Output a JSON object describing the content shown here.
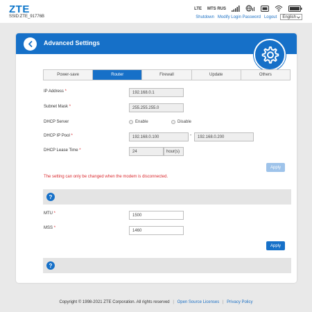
{
  "header": {
    "logo": "ZTE",
    "ssid": "SSID:ZTE_91776B",
    "network_type": "LTE",
    "operator": "MTS RUS",
    "links": {
      "shutdown": "Shutdown",
      "modify_password": "Modify Login Password",
      "logout": "Logout"
    },
    "language": "English"
  },
  "page": {
    "title": "Advanced Settings"
  },
  "tabs": [
    "Power-save",
    "Router",
    "Firewall",
    "Update",
    "Others"
  ],
  "active_tab": "Router",
  "router": {
    "ip_address_label": "IP Address",
    "ip_address": "192.168.0.1",
    "subnet_mask_label": "Subnet Mask",
    "subnet_mask": "255.255.255.0",
    "dhcp_server_label": "DHCP Server",
    "enable_label": "Enable",
    "disable_label": "Disable",
    "dhcp_pool_label": "DHCP IP Pool",
    "dhcp_pool_start": "192.168.0.100",
    "dhcp_pool_dash": "-",
    "dhcp_pool_end": "192.168.0.200",
    "lease_label": "DHCP Lease Time",
    "lease_value": "24",
    "lease_unit": "hour(s)",
    "apply_label": "Apply",
    "warning": "The setting can only be changed when the modem is disconnected."
  },
  "mtu": {
    "mtu_label": "MTU",
    "mtu_value": "1500",
    "mss_label": "MSS",
    "mss_value": "1460",
    "apply_label": "Apply"
  },
  "help": {
    "icon_char": "?"
  },
  "required_mark": "*",
  "footer": {
    "copyright": "Copyright © 1998-2021 ZTE Corporation. All rights reserved",
    "sep": "|",
    "open_source": "Open Source Licenses",
    "privacy": "Privacy Policy"
  },
  "colors": {
    "accent": "#1670c8",
    "warning": "#d9282d",
    "page_bg": "#e9e9e9"
  }
}
